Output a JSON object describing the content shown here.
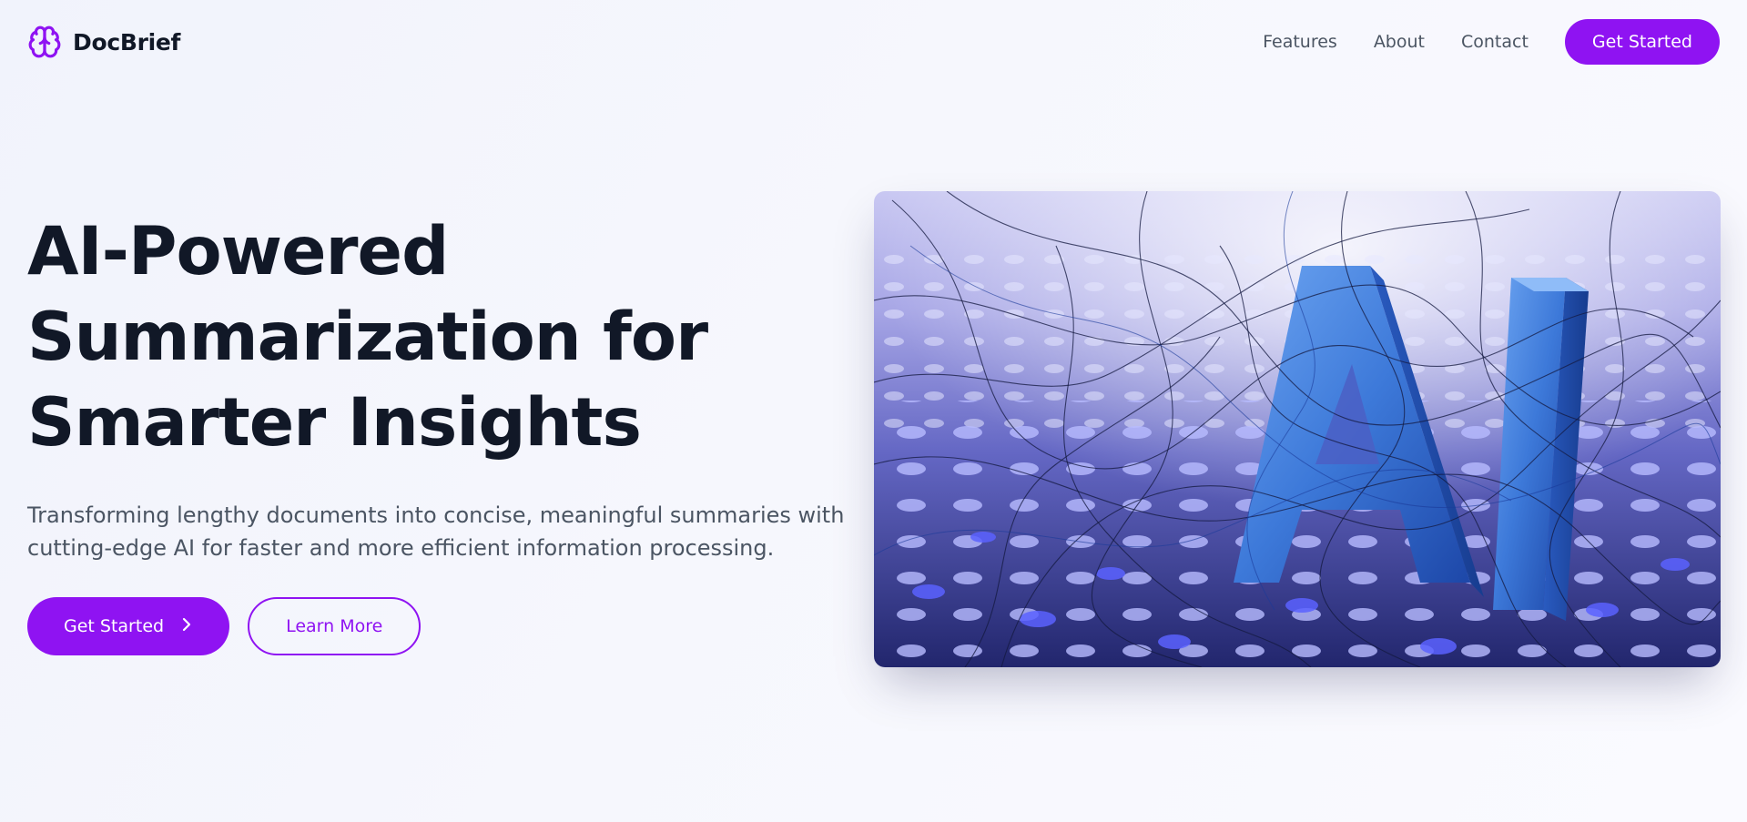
{
  "brand": {
    "name": "DocBrief",
    "icon": "brain-icon",
    "accent_color": "#8f13f2"
  },
  "nav": {
    "links": [
      "Features",
      "About",
      "Contact"
    ],
    "cta_label": "Get Started"
  },
  "hero": {
    "title": "AI-Powered Summarization for Smarter Insights",
    "subtitle": "Transforming lengthy documents into concise, meaningful summaries with cutting-edge AI for faster and more efficient information processing.",
    "primary_button": "Get Started",
    "primary_button_icon": "chevron-right-icon",
    "secondary_button": "Learn More"
  },
  "colors": {
    "heading": "#111827",
    "body_text": "#4b5563",
    "accent": "#8f13f2"
  }
}
